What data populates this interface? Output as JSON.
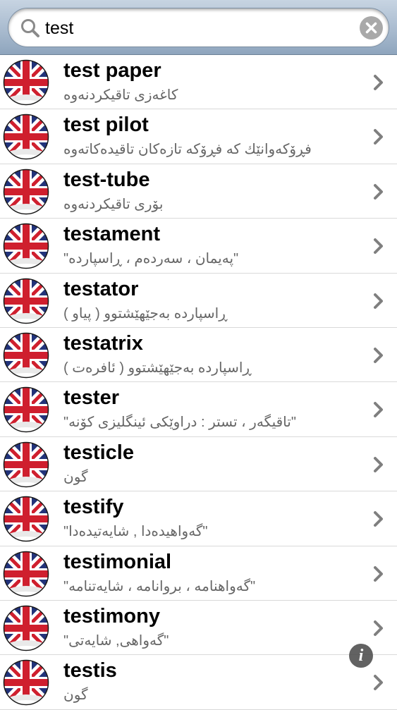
{
  "search": {
    "query": "test"
  },
  "icons": {
    "search": "search-icon",
    "clear": "clear-icon",
    "flag": "uk-flag-icon",
    "chevron": "chevron-right-icon",
    "info": "info-icon"
  },
  "colors": {
    "bar_top": "#c7d4e2",
    "bar_bottom": "#8ea5bd",
    "flag_blue": "#22337a",
    "flag_red": "#cf1f2e",
    "translation_text": "#666666",
    "chevron": "#7f7f7f"
  },
  "info_label": "i",
  "results": [
    {
      "word": "test paper",
      "translation": "کاغەزی تاقیکردنەوە"
    },
    {
      "word": "test pilot",
      "translation": "فڕۆکەوانێك کە فڕۆکە تازەکان تاقیدەکاتەوە"
    },
    {
      "word": "test-tube",
      "translation": "بۆری تاقیکردنەوە"
    },
    {
      "word": "testament",
      "translation": "\"پەیمان ، سەردەم ، ڕاسپاردە\""
    },
    {
      "word": "testator",
      "translation": "ڕاسپاردە بەجێهێشتوو ( پیاو )"
    },
    {
      "word": "testatrix",
      "translation": "ڕاسپاردە بەجێهێشتوو ( ئافرەت )"
    },
    {
      "word": "tester",
      "translation": "\"تاقیگەر ، تستر : دراوێکی ئینگلیزی کۆنە\""
    },
    {
      "word": "testicle",
      "translation": "گون"
    },
    {
      "word": "testify",
      "translation": "\"گەواهیدەدا , شایەتیدەدا\""
    },
    {
      "word": "testimonial",
      "translation": "\"گەواهنامە ، بروانامە ، شایەتنامە\""
    },
    {
      "word": "testimony",
      "translation": "\"گەواهی, شایەتی\""
    },
    {
      "word": "testis",
      "translation": "گون"
    }
  ]
}
